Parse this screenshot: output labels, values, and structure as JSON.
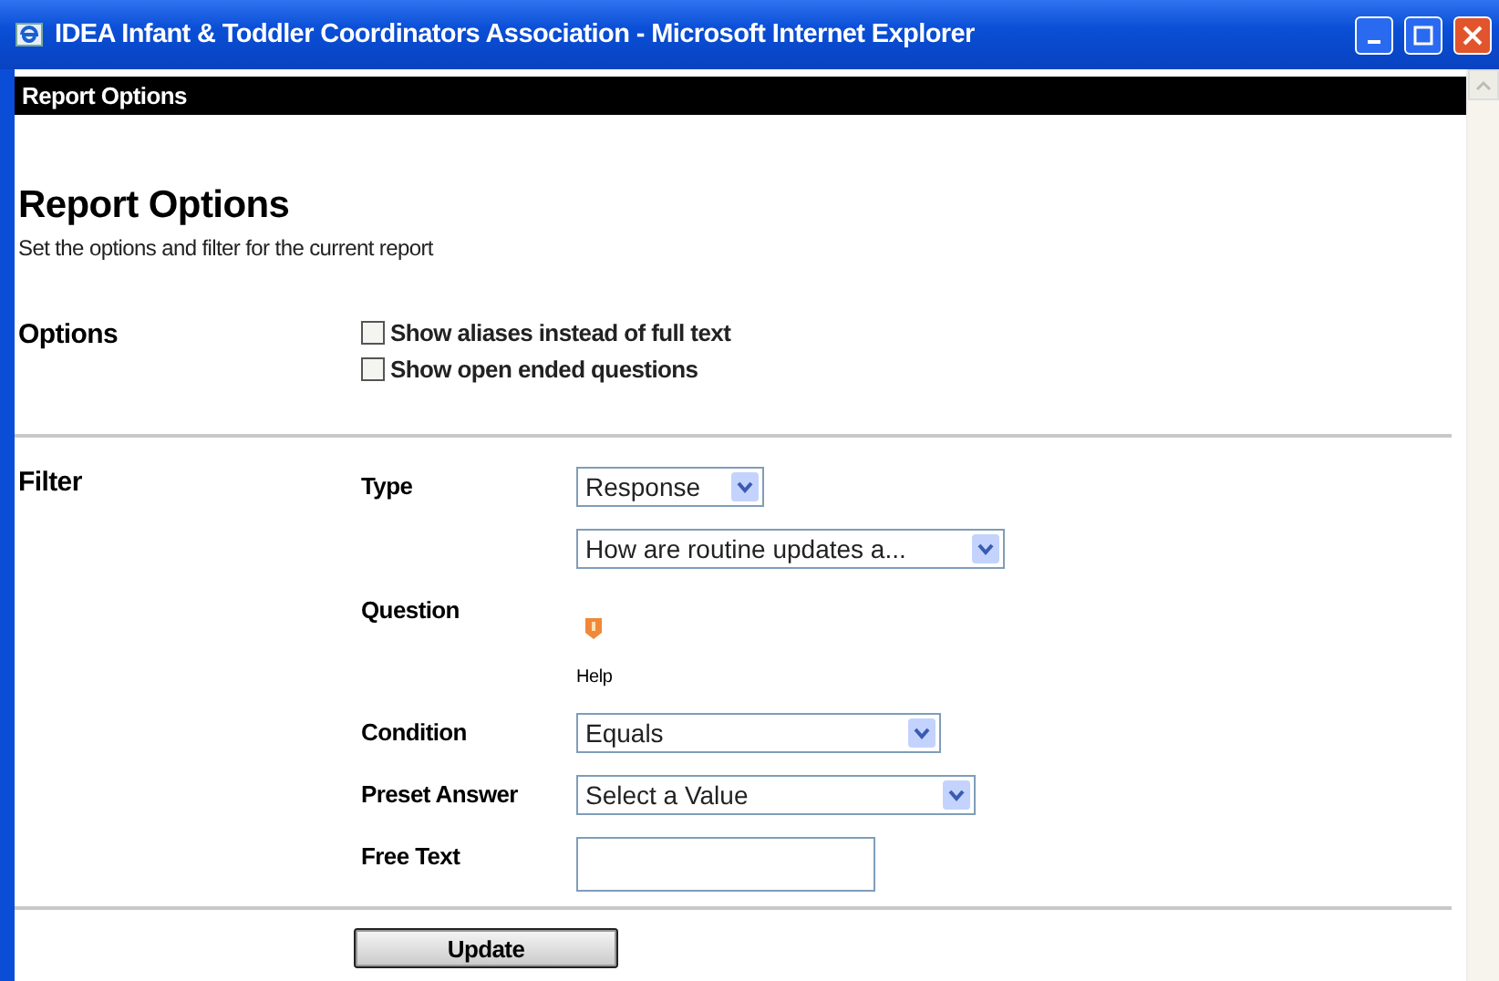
{
  "window": {
    "title": "IDEA Infant & Toddler Coordinators Association - Microsoft Internet Explorer"
  },
  "page_bar": {
    "title": "Report Options"
  },
  "heading": "Report Options",
  "subtitle": "Set the options and filter for the current report",
  "options": {
    "label": "Options",
    "checkboxes": [
      {
        "label": "Show aliases instead of full text",
        "checked": false
      },
      {
        "label": "Show open ended questions",
        "checked": false
      }
    ]
  },
  "filter": {
    "label": "Filter",
    "type": {
      "label": "Type",
      "value": "Response"
    },
    "question": {
      "label": "Question",
      "value": "How are routine updates a...",
      "help": "Help"
    },
    "condition": {
      "label": "Condition",
      "value": "Equals"
    },
    "preset_answer": {
      "label": "Preset Answer",
      "value": "Select a Value"
    },
    "free_text": {
      "label": "Free Text"
    }
  },
  "update_button": "Update"
}
